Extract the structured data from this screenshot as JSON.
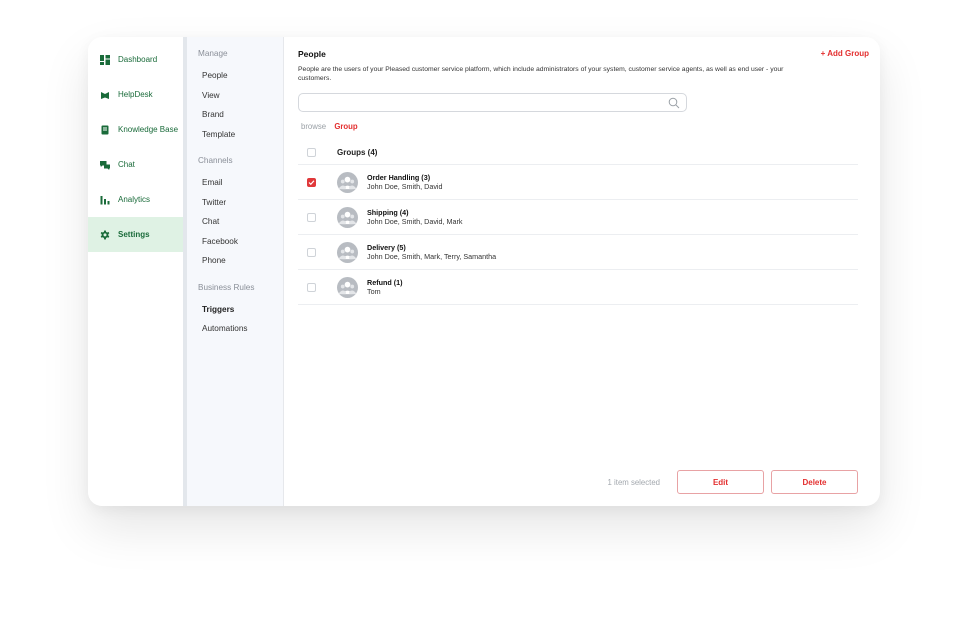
{
  "nav": {
    "items": [
      {
        "label": "Dashboard",
        "icon": "dashboard-icon",
        "active": false
      },
      {
        "label": "HelpDesk",
        "icon": "helpdesk-icon",
        "active": false
      },
      {
        "label": "Knowledge Base",
        "icon": "knowledge-base-icon",
        "active": false
      },
      {
        "label": "Chat",
        "icon": "chat-icon",
        "active": false
      },
      {
        "label": "Analytics",
        "icon": "analytics-icon",
        "active": false
      },
      {
        "label": "Settings",
        "icon": "gear-icon",
        "active": true
      }
    ],
    "accent_color": "#1a6b3a",
    "active_bg": "#dff2e4"
  },
  "submenu": {
    "manage": {
      "title": "Manage",
      "items": [
        "People",
        "View",
        "Brand",
        "Template"
      ]
    },
    "channels": {
      "title": "Channels",
      "items": [
        "Email",
        "Twitter",
        "Chat",
        "Facebook",
        "Phone"
      ]
    },
    "business_rules": {
      "title": "Business Rules",
      "items": [
        "Triggers",
        "Automations"
      ]
    }
  },
  "main": {
    "title": "People",
    "add_group_label": "+ Add Group",
    "description": "People are the users of your Pleased customer service platform, which include administrators of your system, customer service agents, as well as end user - your customers.",
    "search": {
      "value": "",
      "placeholder": ""
    },
    "filters": {
      "browse": "browse",
      "group": "Group"
    },
    "table": {
      "header": "Groups (4)",
      "rows": [
        {
          "title": "Order Handling (3)",
          "members": "John Doe, Smith, David",
          "checked": true
        },
        {
          "title": "Shipping (4)",
          "members": "John Doe, Smith, David, Mark",
          "checked": false
        },
        {
          "title": "Delivery (5)",
          "members": "John Doe, Smith, Mark, Terry, Samantha",
          "checked": false
        },
        {
          "title": "Refund (1)",
          "members": "Tom",
          "checked": false
        }
      ]
    },
    "footer": {
      "selected_text": "1 item selected",
      "edit_label": "Edit",
      "delete_label": "Delete"
    },
    "accent_color": "#e32f2f"
  }
}
